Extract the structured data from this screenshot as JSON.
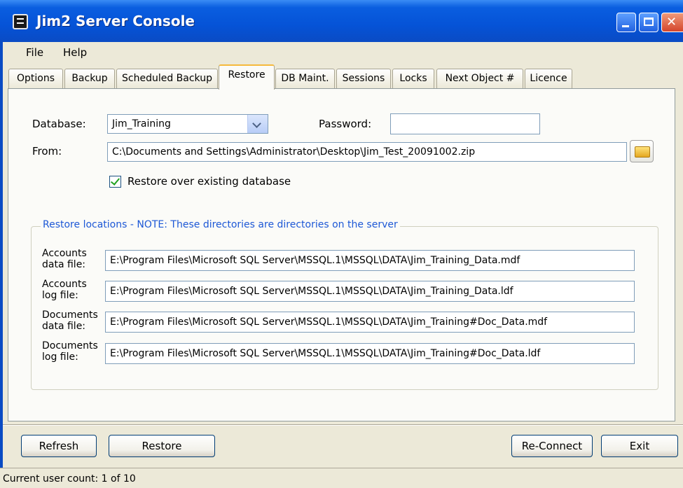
{
  "window": {
    "title": "Jim2 Server Console"
  },
  "menu": {
    "file": "File",
    "help": "Help"
  },
  "tabs": [
    {
      "label": "Options"
    },
    {
      "label": "Backup"
    },
    {
      "label": "Scheduled Backup"
    },
    {
      "label": "Restore"
    },
    {
      "label": "DB Maint."
    },
    {
      "label": "Sessions"
    },
    {
      "label": "Locks"
    },
    {
      "label": "Next Object #"
    },
    {
      "label": "Licence"
    }
  ],
  "active_tab": "Restore",
  "restore": {
    "database_label": "Database:",
    "database_value": "Jim_Training",
    "password_label": "Password:",
    "password_value": "",
    "from_label": "From:",
    "from_value": "C:\\Documents and Settings\\Administrator\\Desktop\\Jim_Test_20091002.zip",
    "restore_over_label": "Restore over existing database",
    "restore_over_checked": true
  },
  "locations": {
    "legend": "Restore locations - NOTE: These directories are directories on the server",
    "rows": [
      {
        "label_line1": "Accounts",
        "label_line2": "data file:",
        "value": "E:\\Program Files\\Microsoft SQL Server\\MSSQL.1\\MSSQL\\DATA\\Jim_Training_Data.mdf"
      },
      {
        "label_line1": "Accounts",
        "label_line2": "log file:",
        "value": "E:\\Program Files\\Microsoft SQL Server\\MSSQL.1\\MSSQL\\DATA\\Jim_Training_Data.ldf"
      },
      {
        "label_line1": "Documents",
        "label_line2": "data file:",
        "value": "E:\\Program Files\\Microsoft SQL Server\\MSSQL.1\\MSSQL\\DATA\\Jim_Training#Doc_Data.mdf"
      },
      {
        "label_line1": "Documents",
        "label_line2": "log file:",
        "value": "E:\\Program Files\\Microsoft SQL Server\\MSSQL.1\\MSSQL\\DATA\\Jim_Training#Doc_Data.ldf"
      }
    ]
  },
  "buttons": {
    "refresh": "Refresh",
    "restore": "Restore",
    "reconnect": "Re-Connect",
    "exit": "Exit"
  },
  "status": {
    "text": "Current user count: 1 of 10"
  }
}
